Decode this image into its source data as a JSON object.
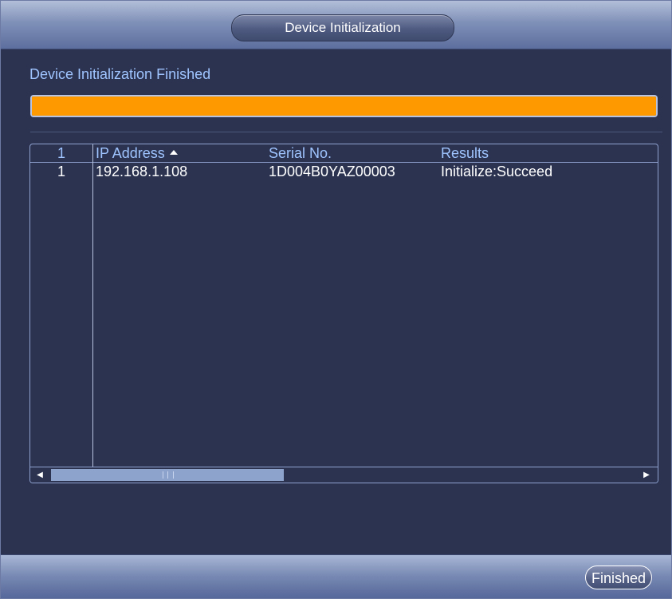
{
  "dialog": {
    "title": "Device Initialization",
    "status_text": "Device Initialization Finished",
    "progress_fraction": 1.0,
    "colors": {
      "progress": "#ff9900",
      "accent_text": "#9fc4ff"
    }
  },
  "table": {
    "headers": {
      "index": "1",
      "ip": "IP Address",
      "serial": "Serial No.",
      "results": "Results"
    },
    "sorted_by": "ip",
    "rows": [
      {
        "index": "1",
        "ip": "192.168.1.108",
        "serial": "1D004B0YAZ00003",
        "results": "Initialize:Succeed"
      }
    ]
  },
  "footer": {
    "finish_label": "Finished"
  }
}
